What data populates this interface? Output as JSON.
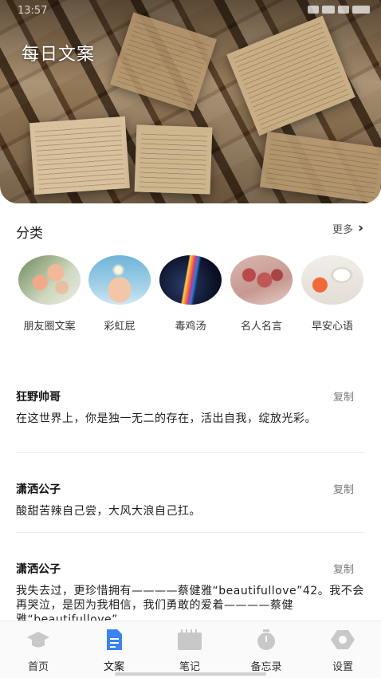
{
  "status_bar": {
    "time": "13:57"
  },
  "hero": {
    "title": "每日文案"
  },
  "categories_section": {
    "title": "分类",
    "more_label": "更多",
    "items": [
      {
        "label": "朋友圈文案",
        "icon": "flowers-image"
      },
      {
        "label": "彩虹屁",
        "icon": "hands-light-image"
      },
      {
        "label": "毒鸡汤",
        "icon": "prism-image"
      },
      {
        "label": "名人名言",
        "icon": "roses-image"
      },
      {
        "label": "早安心语",
        "icon": "coffee-flowers-image"
      }
    ]
  },
  "quotes": [
    {
      "author": "狂野帅哥",
      "copy_label": "复制",
      "text": "在这世界上，你是独一无二的存在，活出自我，绽放光彩。"
    },
    {
      "author": "潇洒公子",
      "copy_label": "复制",
      "text": "酸甜苦辣自己尝，大风大浪自己扛。"
    },
    {
      "author": "潇洒公子",
      "copy_label": "复制",
      "text": "我失去过，更珍惜拥有————蔡健雅“beautifullove”42。我不会再哭泣，是因为我相信，我们勇敢的爱着————蔡健雅“beautifullove”"
    }
  ],
  "tabbar": {
    "items": [
      {
        "label": "首页",
        "icon": "graduation-cap-icon"
      },
      {
        "label": "文案",
        "icon": "document-icon",
        "active": true
      },
      {
        "label": "笔记",
        "icon": "notebook-icon"
      },
      {
        "label": "备忘录",
        "icon": "stopwatch-icon"
      },
      {
        "label": "设置",
        "icon": "settings-hexagon-icon"
      }
    ]
  },
  "colors": {
    "accent": "#3b82f6",
    "inactive_icon": "#c8c8c8"
  }
}
